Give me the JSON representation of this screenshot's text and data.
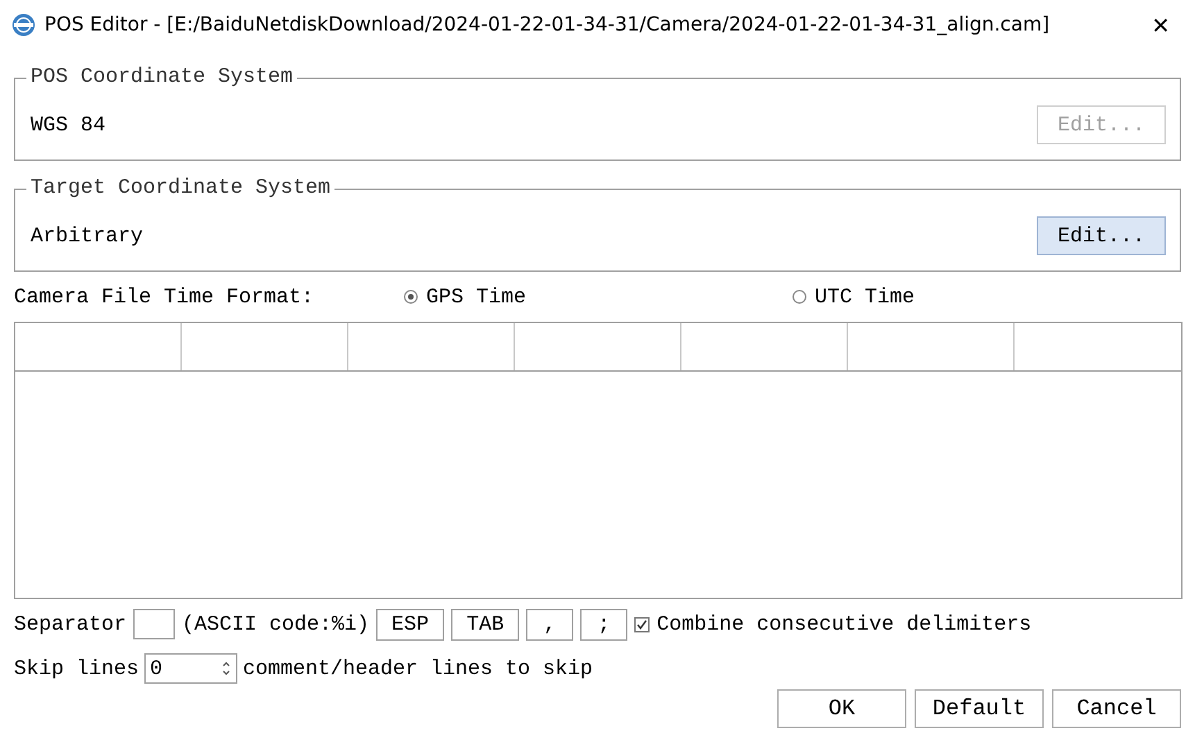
{
  "window": {
    "title": "POS Editor - [E:/BaiduNetdiskDownload/2024-01-22-01-34-31/Camera/2024-01-22-01-34-31_align.cam]",
    "close": "✕"
  },
  "groups": [
    {
      "title": "POS Coordinate System",
      "value": "WGS 84",
      "button": {
        "label": "Edit...",
        "disabled": true,
        "focused": false
      }
    },
    {
      "title": "Target Coordinate System",
      "value": "Arbitrary",
      "button": {
        "label": "Edit...",
        "disabled": false,
        "focused": true
      }
    }
  ],
  "time_format": {
    "label": "Camera File Time Format:",
    "options": [
      {
        "label": "GPS Time",
        "selected": true
      },
      {
        "label": "UTC Time",
        "selected": false
      }
    ]
  },
  "separator": {
    "label": "Separator",
    "hint": "(ASCII code:%i)",
    "buttons": [
      "ESP",
      "TAB",
      ",",
      ";"
    ],
    "combine": {
      "label": "Combine consecutive delimiters",
      "checked": true
    }
  },
  "skip": {
    "label": "Skip lines",
    "value": "0",
    "hint": "comment/header lines to skip"
  },
  "buttons": [
    "OK",
    "Default",
    "Cancel"
  ]
}
